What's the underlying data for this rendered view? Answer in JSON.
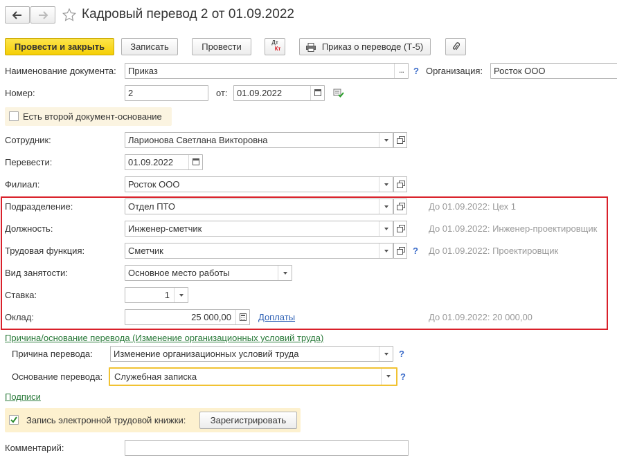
{
  "window": {
    "title": "Кадровый перевод 2 от 01.09.2022"
  },
  "toolbar": {
    "post_close_label": "Провести и закрыть",
    "save_label": "Записать",
    "post_label": "Провести",
    "dtkt_top": "Дт",
    "dtkt_bottom": "Кт",
    "print_label": "Приказ о переводе (Т-5)"
  },
  "form": {
    "doc_name_label": "Наименование документа:",
    "doc_name_value": "Приказ",
    "org_label": "Организация:",
    "org_value": "Росток ООО",
    "number_label": "Номер:",
    "number_value": "2",
    "from_label": "от:",
    "date_value": "01.09.2022",
    "second_doc_label": "Есть второй документ-основание",
    "employee_label": "Сотрудник:",
    "employee_value": "Ларионова Светлана Викторовна",
    "transfer_label": "Перевести:",
    "transfer_date": "01.09.2022",
    "branch_label": "Филиал:",
    "branch_value": "Росток ООО",
    "dept_label": "Подразделение:",
    "dept_value": "Отдел ПТО",
    "dept_hint": "До 01.09.2022: Цех 1",
    "position_label": "Должность:",
    "position_value": "Инженер-сметчик",
    "position_hint": "До 01.09.2022: Инженер-проектировщик",
    "labor_func_label": "Трудовая функция:",
    "labor_func_value": "Сметчик",
    "labor_func_hint": "До 01.09.2022: Проектировщик",
    "employment_label": "Вид занятости:",
    "employment_value": "Основное место работы",
    "rate_label": "Ставка:",
    "rate_value": "1",
    "salary_label": "Оклад:",
    "salary_value": "25 000,00",
    "extra_link": "Доплаты",
    "salary_hint": "До 01.09.2022: 20 000,00",
    "reason_link": "Причина/основание перевода (Изменение организационных условий труда)",
    "reason_label": "Причина перевода:",
    "reason_value": "Изменение организационных условий труда",
    "basis_label": "Основание перевода:",
    "basis_value": "Служебная записка",
    "signatures_link": "Подписи",
    "etk_label": "Запись электронной трудовой книжки:",
    "register_label": "Зарегистрировать",
    "comment_label": "Комментарий:",
    "comment_value": "",
    "help_mark": "?",
    "dots": "..."
  },
  "colors": {
    "primary_button": "#f5cf05",
    "highlight_border": "#d9202a",
    "basis_focus_border": "#f1c232",
    "etk_background": "#fdf1cf",
    "link_green": "#2a7a3a",
    "help_blue": "#3a6bc9",
    "hint_gray": "#999999"
  }
}
